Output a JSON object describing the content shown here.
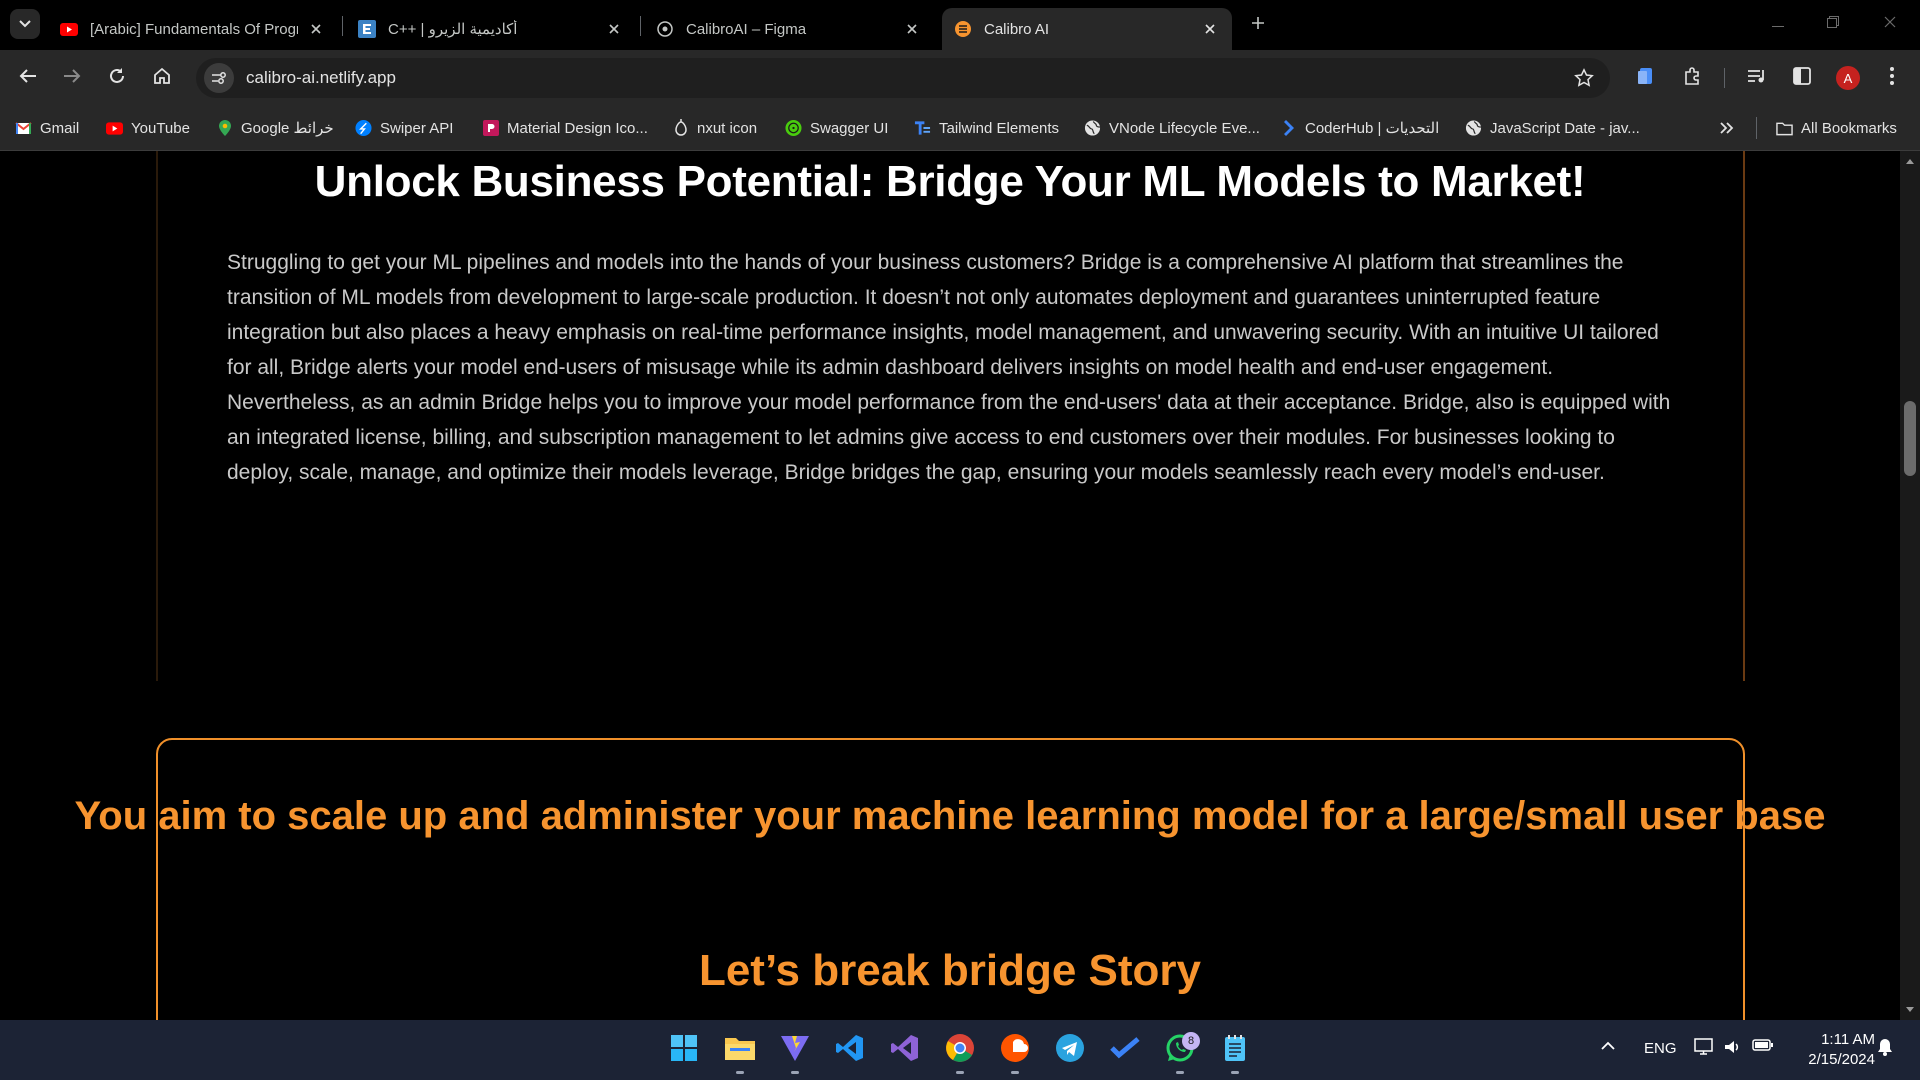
{
  "browser": {
    "tabs": [
      {
        "title": "[Arabic] Fundamentals Of Progr",
        "favicon": "youtube-icon",
        "active": false
      },
      {
        "title": "C++ | أكاديمية الزيرو",
        "favicon": "e-icon",
        "active": false
      },
      {
        "title": "CalibroAI – Figma",
        "favicon": "figma-icon",
        "active": false
      },
      {
        "title": "Calibro AI",
        "favicon": "calibro-icon",
        "active": true
      }
    ],
    "url": "calibro-ai.netlify.app",
    "profile_initial": "A",
    "bookmarks": [
      {
        "label": "Gmail",
        "icon": "gmail-icon"
      },
      {
        "label": "YouTube",
        "icon": "youtube-icon"
      },
      {
        "label": "Google خرائط",
        "icon": "maps-icon"
      },
      {
        "label": "Swiper API",
        "icon": "swiper-icon"
      },
      {
        "label": "Material Design Ico...",
        "icon": "material-icon"
      },
      {
        "label": "nxut icon",
        "icon": "nuxt-icon"
      },
      {
        "label": "Swagger UI",
        "icon": "swagger-icon"
      },
      {
        "label": "Tailwind Elements",
        "icon": "tailwind-icon"
      },
      {
        "label": "VNode Lifecycle Eve...",
        "icon": "globe-icon"
      },
      {
        "label": "CoderHub | التحديات",
        "icon": "coderhub-icon"
      },
      {
        "label": "JavaScript Date - jav...",
        "icon": "globe-icon"
      }
    ],
    "all_bookmarks_label": "All Bookmarks"
  },
  "page": {
    "heading": "Unlock Business Potential: Bridge Your ML Models to Market!",
    "paragraph": "Struggling to get your ML pipelines and models into the hands of your business customers? Bridge is a comprehensive AI platform that streamlines the transition of ML models from development to large-scale production. It doesn’t not only automates deployment and guarantees uninterrupted feature integration but also places a heavy emphasis on real-time performance insights, model management, and unwavering security. With an intuitive UI tailored for all, Bridge alerts your model end-users of misusage while its admin dashboard delivers insights on model health and end-user engagement. Nevertheless, as an admin Bridge helps you to improve your model performance from the end-users' data at their acceptance. Bridge, also is equipped with an integrated license, billing, and subscription management to let admins give access to end customers over their modules. For businesses looking to deploy, scale, manage, and optimize their models leverage, Bridge bridges the gap, ensuring your models seamlessly reach every model’s end-user.",
    "card_heading_1": "You aim to scale up and administer your machine learning model for a large/small user base",
    "card_heading_2": "Let’s break bridge Story"
  },
  "taskbar": {
    "apps": [
      "start-icon",
      "file-explorer-icon",
      "vite-icon",
      "vscode-icon",
      "visual-studio-icon",
      "chrome-icon",
      "soundcloud-icon",
      "telegram-icon",
      "todo-icon",
      "whatsapp-icon",
      "notepad-icon"
    ],
    "whatsapp_badge": "8",
    "language": "ENG",
    "time": "1:11 AM",
    "date": "2/15/2024"
  },
  "colors": {
    "accent_orange": "#f7942f",
    "page_bg": "#000000",
    "chrome_bg": "#282828"
  }
}
